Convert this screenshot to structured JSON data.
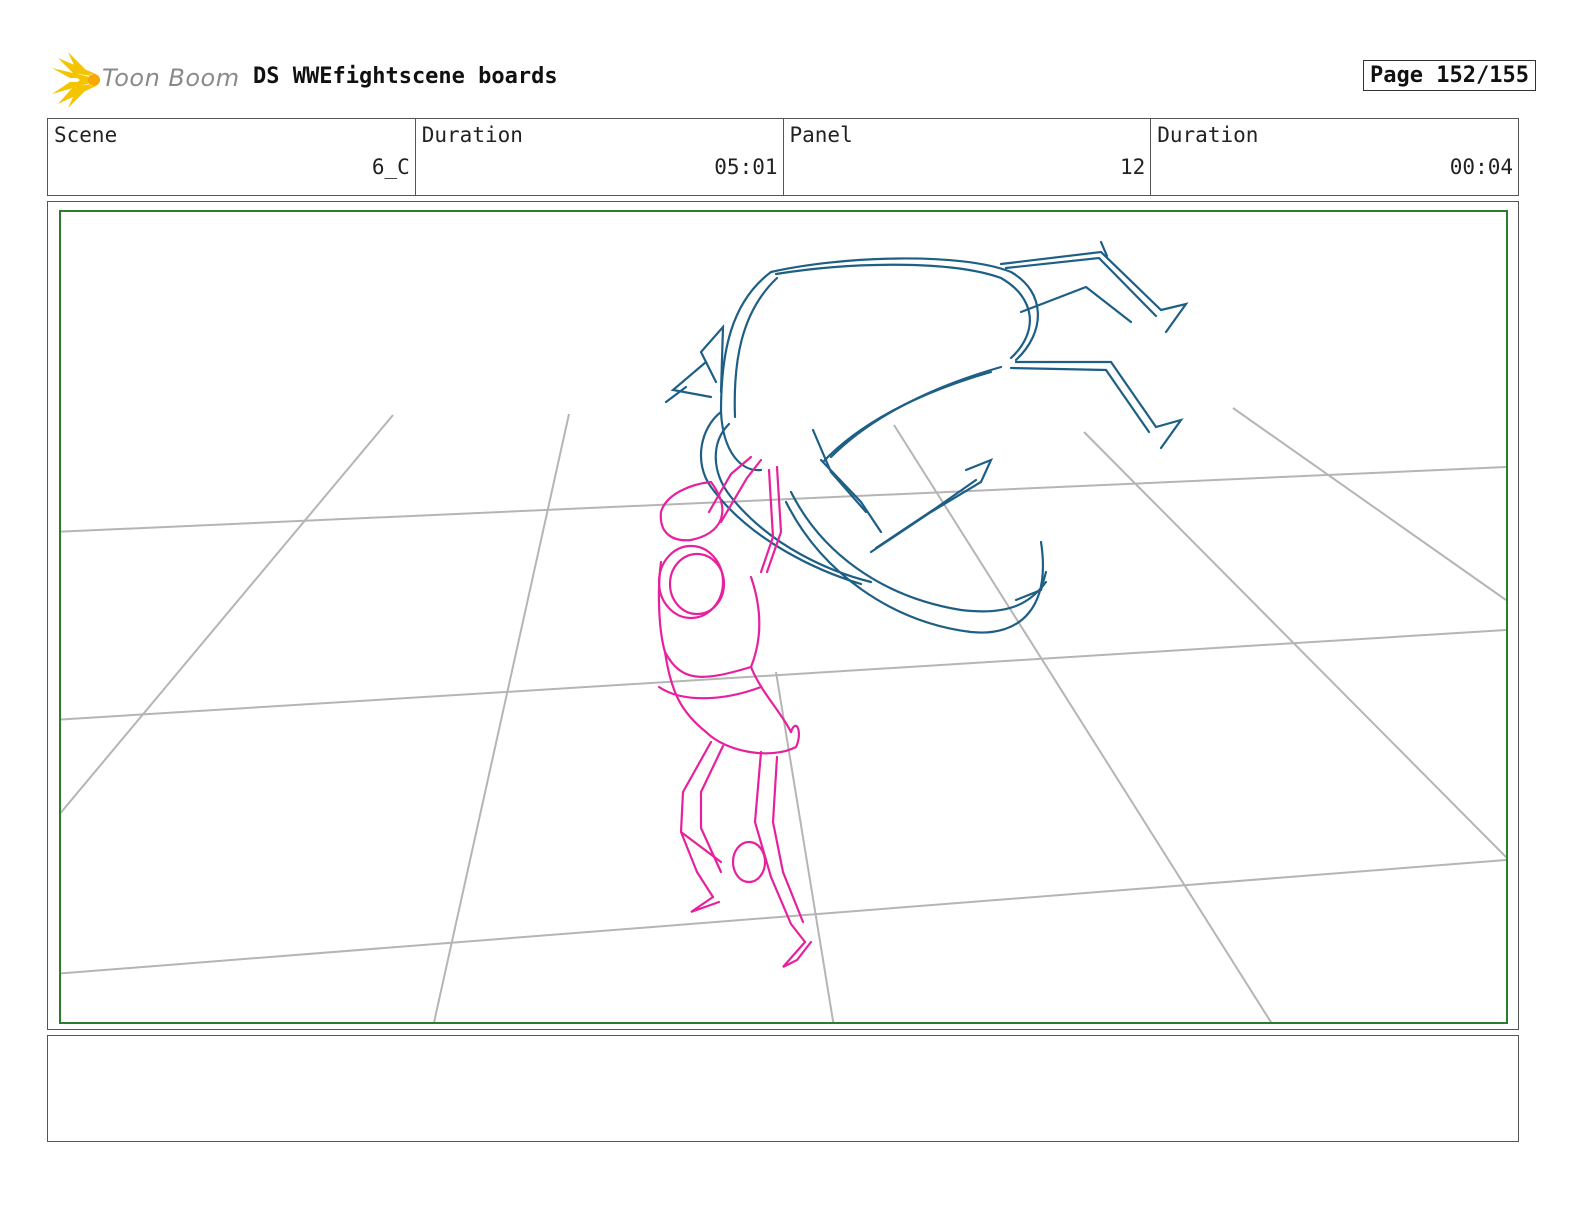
{
  "header": {
    "logo_text": "Toon Boom",
    "project_title": "DS WWEfightscene boards",
    "page": "Page 152/155"
  },
  "info": {
    "scene_label": "Scene",
    "scene_value": "6_C",
    "scene_duration_label": "Duration",
    "scene_duration_value": "05:01",
    "panel_label": "Panel",
    "panel_value": "12",
    "panel_duration_label": "Duration",
    "panel_duration_value": "00:04"
  },
  "colors": {
    "frame_border": "#2e7a2e",
    "grid_lines": "#b5b5b5",
    "thrown_figure": "#1e5f85",
    "lifting_figure": "#e6219e",
    "logo_star": "#f5c400"
  },
  "notes": {
    "text": ""
  }
}
